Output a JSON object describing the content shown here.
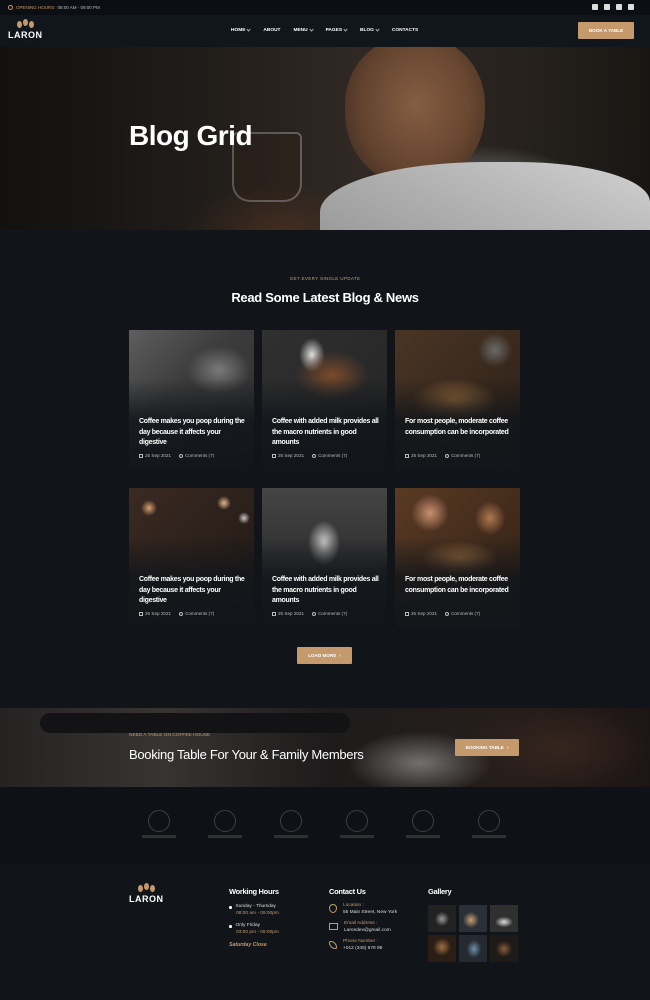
{
  "topbar": {
    "hours_label": "OPENING HOURS:",
    "hours_value": "08:00 AM - 09:00 PM",
    "social": [
      "facebook-icon",
      "twitter-icon",
      "instagram-icon",
      "youtube-icon"
    ]
  },
  "nav": {
    "logo": "LARON",
    "menu": [
      {
        "label": "HOME",
        "dropdown": true
      },
      {
        "label": "ABOUT",
        "dropdown": false
      },
      {
        "label": "MENU",
        "dropdown": true
      },
      {
        "label": "PAGES",
        "dropdown": true
      },
      {
        "label": "BLOG",
        "dropdown": true
      },
      {
        "label": "CONTACTS",
        "dropdown": false
      }
    ],
    "cta": "BOOK A TABLE"
  },
  "hero": {
    "title": "Blog Grid"
  },
  "blog": {
    "eyebrow": "GET EVERY SINGLE UPDATE",
    "title": "Read Some Latest Blog & News",
    "posts": [
      {
        "title": "Coffee makes you poop during the day because it affects your digestive",
        "date": "25 Sep 2021",
        "comments": "Comments (7)"
      },
      {
        "title": "Coffee with added milk provides all the macro nutrients in good amounts",
        "date": "25 Sep 2021",
        "comments": "Comments (7)"
      },
      {
        "title": "For most people, moderate coffee consumption can be incorporated",
        "date": "25 Sep 2021",
        "comments": "Comments (7)"
      },
      {
        "title": "Coffee makes you poop during the day because it affects your digestive",
        "date": "25 Sep 2021",
        "comments": "Comments (7)"
      },
      {
        "title": "Coffee with added milk provides all the macro nutrients in good amounts",
        "date": "25 Sep 2021",
        "comments": "Comments (7)"
      },
      {
        "title": "For most people, moderate coffee consumption can be incorporated",
        "date": "25 Sep 2021",
        "comments": "Comments (7)"
      }
    ],
    "load_more": "LOAD MORE"
  },
  "booking": {
    "eyebrow": "NEED A TABLE ON COFFEE HOUSE",
    "title": "Booking Table For Your & Family Members",
    "button": "BOOKING TABLE"
  },
  "brands": [
    "coffee-house-logo",
    "tea-house-logo",
    "restaurant-logo",
    "restaurant-plate-logo",
    "restaurant-cloche-logo",
    "restaurant-chef-logo"
  ],
  "footer": {
    "logo": "LARON",
    "working_hours": {
      "title": "Working Hours",
      "rows": [
        {
          "days": "Sunday - Thursday",
          "time": "08:00 am - 09:00pm"
        },
        {
          "days": "Only Friday",
          "time": "03:00 pm - 09:00pm"
        }
      ],
      "closed": "Saturday Close"
    },
    "contact": {
      "title": "Contact Us",
      "location_label": "Location :",
      "location": "55 Main Street, New York",
      "email_label": "Email Address :",
      "email": "Larondev@gmail.com",
      "phone_label": "Phone Number :",
      "phone": "+012 (345) 678 99"
    },
    "gallery": {
      "title": "Gallery"
    }
  },
  "colors": {
    "accent": "#c49a6c",
    "background": "#11151a",
    "dark": "#0b0e12"
  }
}
